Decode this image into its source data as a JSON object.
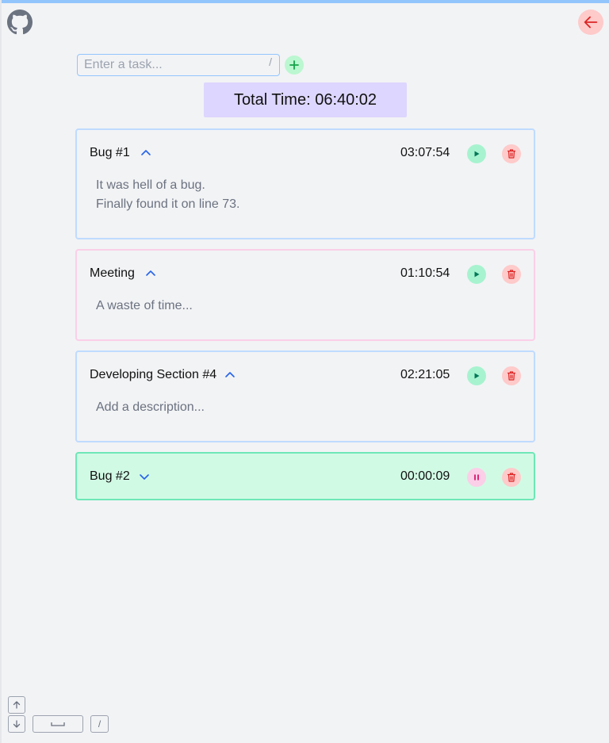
{
  "header": {
    "github_icon": "github-icon",
    "back_icon": "arrow-left-icon"
  },
  "task_entry": {
    "placeholder": "Enter a task...",
    "shortcut_hint": "/",
    "add_icon": "plus-icon"
  },
  "total": {
    "label": "Total Time: 06:40:02"
  },
  "tasks": [
    {
      "name": "Bug #1",
      "time": "03:07:54",
      "expanded": true,
      "running": false,
      "description": "It was hell of a bug.\nFinally found it on line 73.",
      "border_color": "#bfdbfe"
    },
    {
      "name": "Meeting",
      "time": "01:10:54",
      "expanded": true,
      "running": false,
      "description": "A waste of time...",
      "border_color": "#fbcfe8"
    },
    {
      "name": "Developing Section #4",
      "time": "02:21:05",
      "expanded": true,
      "running": false,
      "description_placeholder": "Add a description...",
      "border_color": "#bfdbfe"
    },
    {
      "name": "Bug #2",
      "time": "00:00:09",
      "expanded": false,
      "running": true,
      "border_color": "#6ee7b7"
    }
  ],
  "shortcuts": {
    "slash_key": "/",
    "icons": [
      "arrow-up-key-icon",
      "arrow-down-key-icon",
      "space-key-icon"
    ]
  },
  "colors": {
    "accent_blue": "#93c5fd",
    "play_green": "#a7f3d0",
    "delete_red": "#fecaca",
    "pause_pink": "#fbcfe8",
    "total_bg": "#ddd6fe",
    "active_bg": "#d1fae5"
  }
}
